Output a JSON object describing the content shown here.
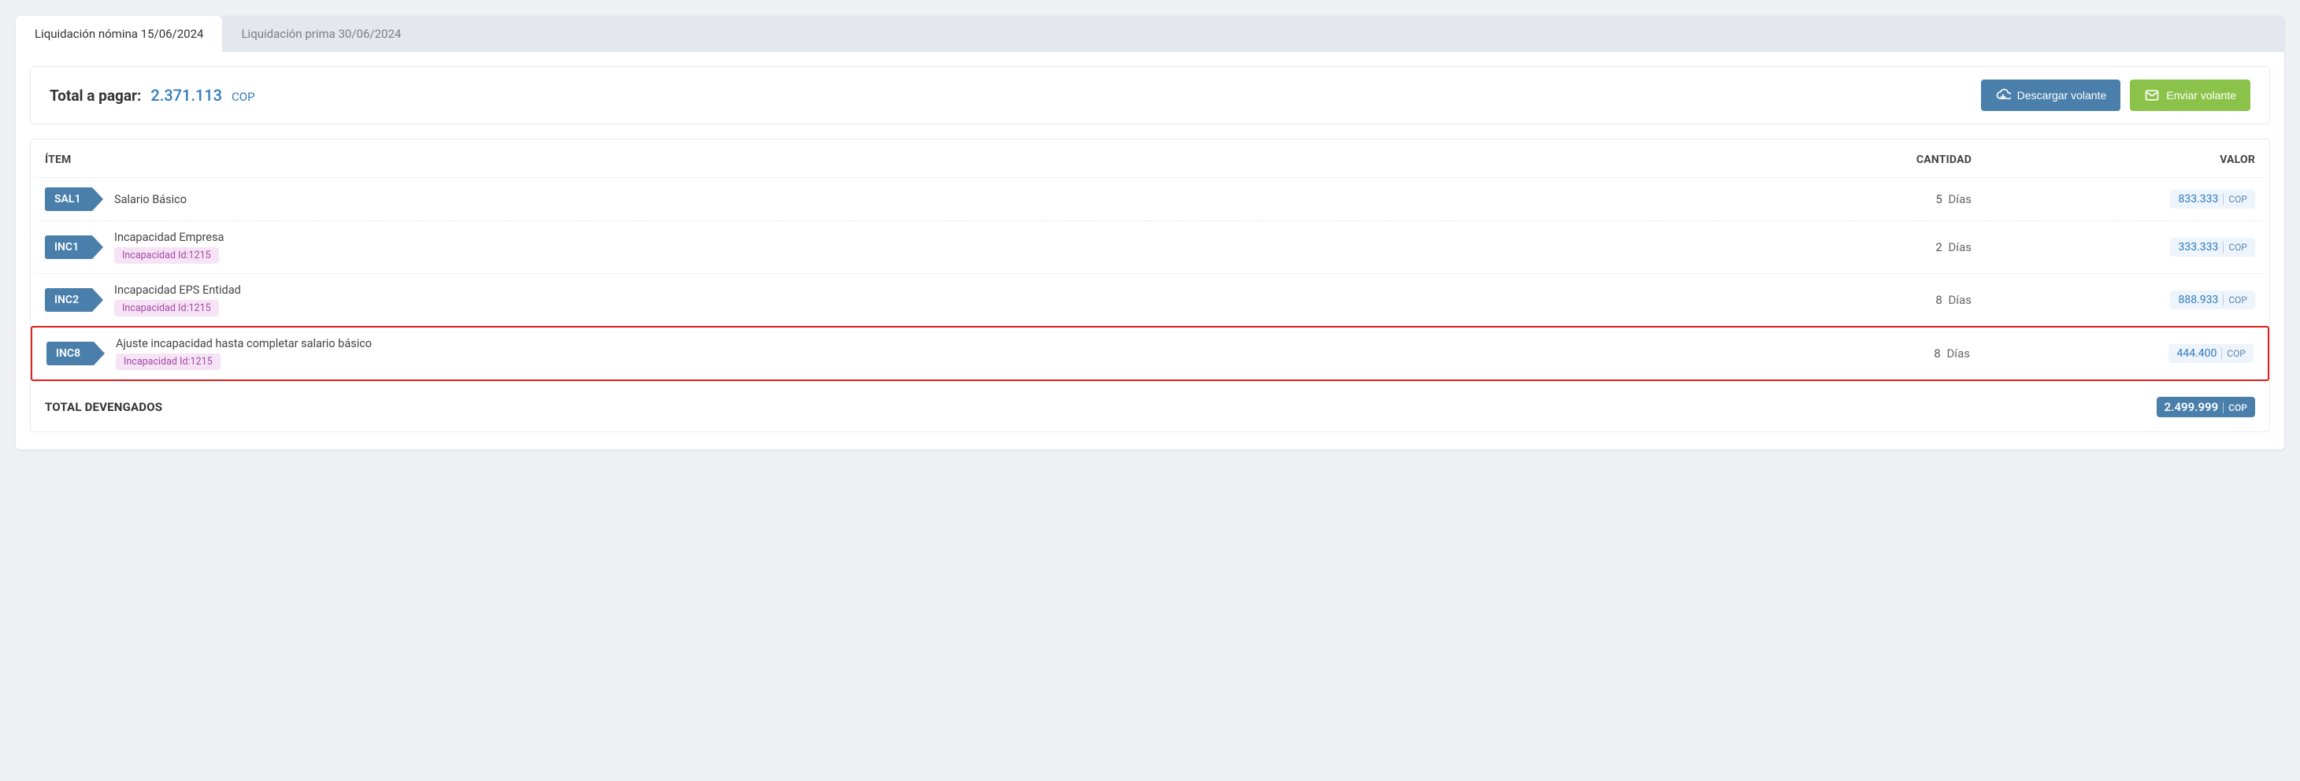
{
  "tabs": [
    {
      "label": "Liquidación nómina 15/06/2024",
      "active": true
    },
    {
      "label": "Liquidación prima 30/06/2024",
      "active": false
    }
  ],
  "summary": {
    "label": "Total a pagar:",
    "amount": "2.371.113",
    "currency": "COP"
  },
  "actions": {
    "download": "Descargar volante",
    "send": "Enviar volante"
  },
  "columns": {
    "item": "ÍTEM",
    "qty": "CANTIDAD",
    "value": "VALOR"
  },
  "rows": [
    {
      "code": "SAL1",
      "name": "Salario Básico",
      "subBadge": null,
      "qty": "5",
      "unit": "Días",
      "value": "833.333",
      "currency": "COP",
      "highlight": false
    },
    {
      "code": "INC1",
      "name": "Incapacidad Empresa",
      "subBadge": "Incapacidad Id:1215",
      "qty": "2",
      "unit": "Días",
      "value": "333.333",
      "currency": "COP",
      "highlight": false
    },
    {
      "code": "INC2",
      "name": "Incapacidad EPS Entidad",
      "subBadge": "Incapacidad Id:1215",
      "qty": "8",
      "unit": "Días",
      "value": "888.933",
      "currency": "COP",
      "highlight": false
    },
    {
      "code": "INC8",
      "name": "Ajuste incapacidad hasta completar salario básico",
      "subBadge": "Incapacidad Id:1215",
      "qty": "8",
      "unit": "Días",
      "value": "444.400",
      "currency": "COP",
      "highlight": true
    }
  ],
  "totals": {
    "label": "TOTAL DEVENGADOS",
    "value": "2.499.999",
    "currency": "COP"
  }
}
